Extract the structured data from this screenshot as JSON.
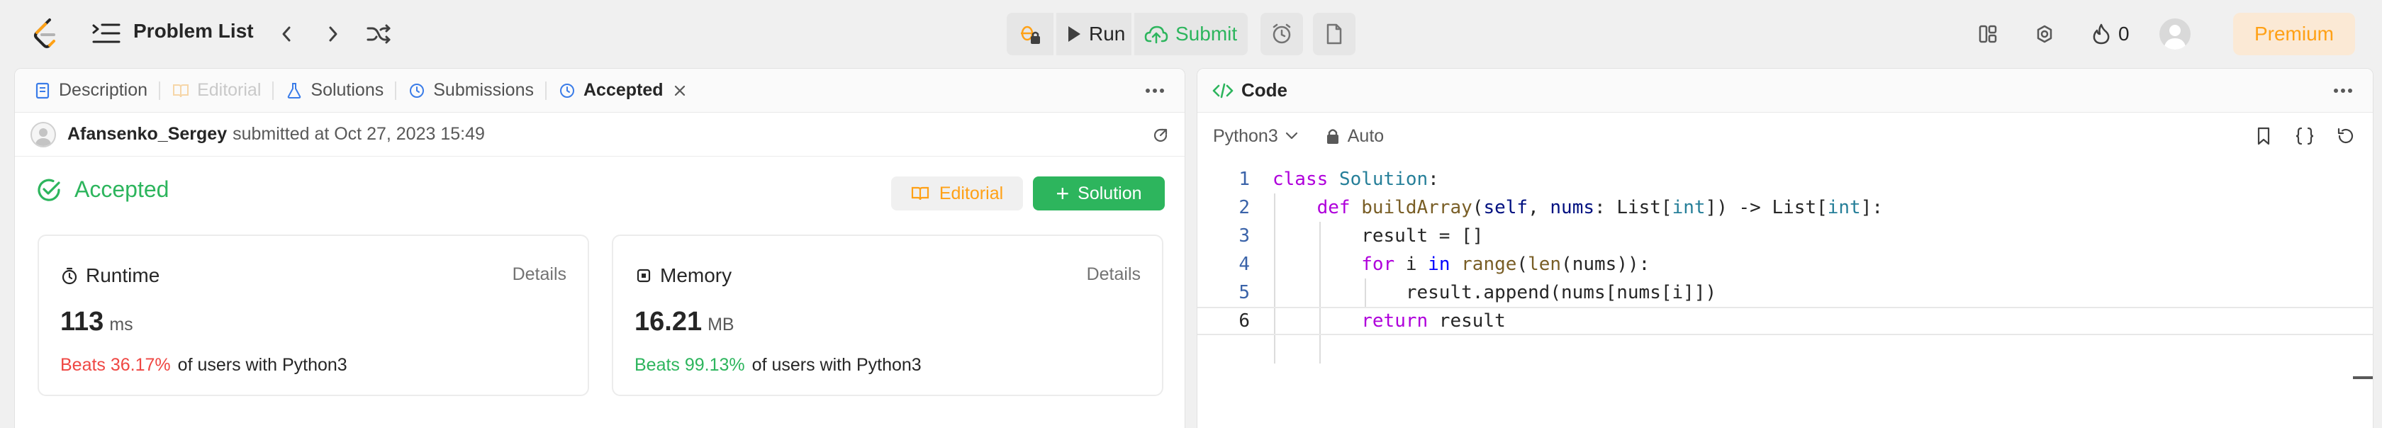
{
  "topbar": {
    "problem_list_label": "Problem List",
    "run_label": "Run",
    "submit_label": "Submit",
    "streak_count": "0",
    "premium_label": "Premium"
  },
  "left_tabs": [
    {
      "label": "Description"
    },
    {
      "label": "Editorial"
    },
    {
      "label": "Solutions"
    },
    {
      "label": "Submissions"
    },
    {
      "label": "Accepted"
    }
  ],
  "submission": {
    "username": "Afansenko_Sergey",
    "submitted_text": "submitted at Oct 27, 2023 15:49",
    "status": "Accepted",
    "editorial_button": "Editorial",
    "solution_button": "Solution"
  },
  "runtime": {
    "title": "Runtime",
    "details": "Details",
    "value": "113",
    "unit": "ms",
    "beats": "Beats 36.17%",
    "rest": "of users with Python3"
  },
  "memory": {
    "title": "Memory",
    "details": "Details",
    "value": "16.21",
    "unit": "MB",
    "beats": "Beats 99.13%",
    "rest": "of users with Python3"
  },
  "code_panel": {
    "title": "Code",
    "language": "Python3",
    "mode": "Auto",
    "line_numbers": [
      "1",
      "2",
      "3",
      "4",
      "5",
      "6"
    ]
  },
  "colors": {
    "accent_green": "#2db55d",
    "brand_orange": "#ffa116",
    "beats_red": "#ef4743"
  }
}
